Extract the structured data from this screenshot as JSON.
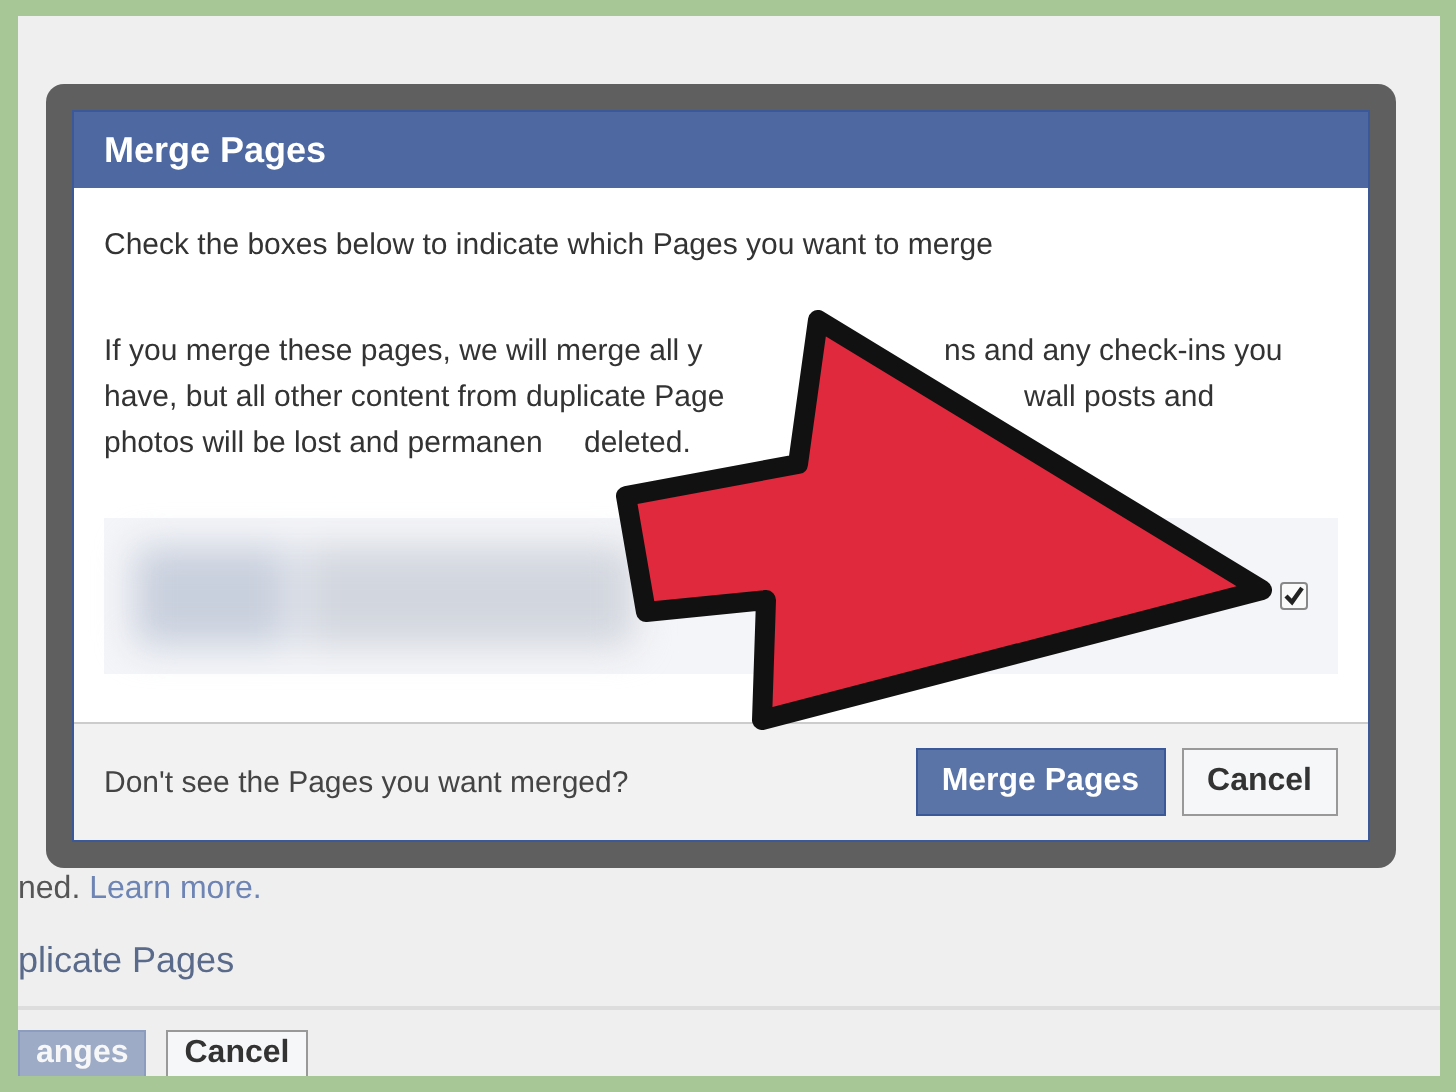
{
  "background_page": {
    "notice": {
      "text": "ned.",
      "link": "Learn more."
    },
    "section_title": "plicate Pages",
    "buttons": [
      {
        "label": "anges",
        "kind": "primary"
      },
      {
        "label": "Cancel",
        "kind": "secondary"
      }
    ]
  },
  "dialog": {
    "title": "Merge Pages",
    "instruction": "Check the boxes below to indicate which Pages you want to merge",
    "warning_lines": [
      [
        "If you merge these pages, we will merge all y",
        "ns and any check-ins you"
      ],
      [
        "have, but all other content from duplicate Page",
        "wall posts and"
      ],
      [
        "photos will be lost and permanen",
        "deleted."
      ]
    ],
    "pages": [
      {
        "checked": true
      }
    ],
    "footer_note": "Don't see the Pages you want merged?",
    "buttons": [
      {
        "label": "Merge Pages",
        "kind": "primary"
      },
      {
        "label": "Cancel",
        "kind": "secondary"
      }
    ]
  }
}
